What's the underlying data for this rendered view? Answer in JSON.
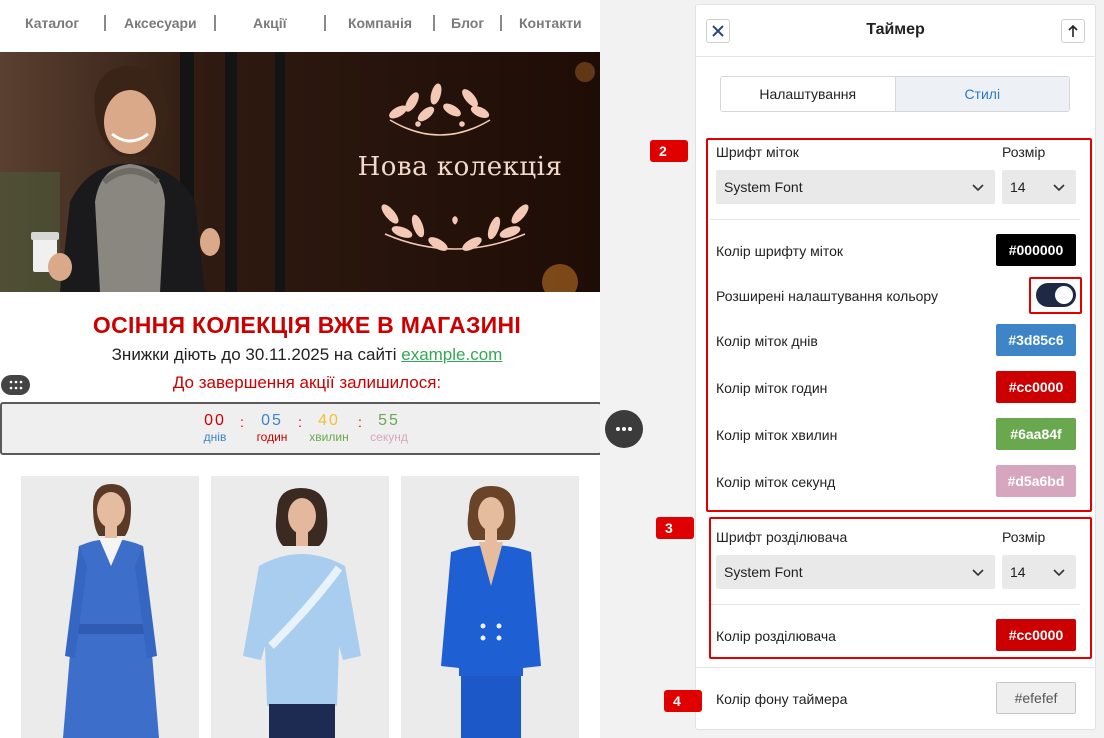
{
  "nav": {
    "items": [
      "Каталог",
      "Аксесуари",
      "Акції",
      "Компанія",
      "Блог",
      "Контакти"
    ]
  },
  "banner": {
    "title": "Нова колекція"
  },
  "promo": {
    "headline": "ОСІННЯ КОЛЕКЦІЯ ВЖЕ В МАГАЗИНІ",
    "subline_text": "Знижки діють до 30.11.2025 на сайті",
    "subline_link": "example.com",
    "countdown_label": "До завершення акції залишилося:"
  },
  "timer": {
    "separator": ":",
    "units": [
      {
        "value": "00",
        "label": "днів",
        "color": "#cc0000",
        "label_color": "#3d85c6"
      },
      {
        "value": "05",
        "label": "годин",
        "color": "#3d85c6",
        "label_color": "#cc0000"
      },
      {
        "value": "40",
        "label": "хвилин",
        "color": "#f1c232",
        "label_color": "#6aa84f"
      },
      {
        "value": "55",
        "label": "секунд",
        "color": "#6aa84f",
        "label_color": "#d5a6bd"
      }
    ],
    "background": "#efefef"
  },
  "panel": {
    "title": "Таймер",
    "close_icon": "close-icon",
    "collapse_icon": "arrow-up-icon",
    "tabs": [
      {
        "label": "Налаштування",
        "active": false
      },
      {
        "label": "Стилі",
        "active": true
      }
    ],
    "labels_font": {
      "label": "Шрифт міток",
      "size_label": "Розмір",
      "font_value": "System Font",
      "size_value": "14"
    },
    "labels_color": {
      "label": "Колір шрифту міток",
      "value": "#000000"
    },
    "advanced_color": {
      "label": "Розширені налаштування кольору",
      "enabled": true
    },
    "days_color": {
      "label": "Колір міток днів",
      "value": "#3d85c6"
    },
    "hours_color": {
      "label": "Колір міток годин",
      "value": "#cc0000"
    },
    "minutes_color": {
      "label": "Колір міток хвилин",
      "value": "#6aa84f"
    },
    "seconds_color": {
      "label": "Колір міток секунд",
      "value": "#d5a6bd"
    },
    "separator_font": {
      "label": "Шрифт розділювача",
      "size_label": "Розмір",
      "font_value": "System Font",
      "size_value": "14"
    },
    "separator_color": {
      "label": "Колір розділювача",
      "value": "#cc0000"
    },
    "timer_bg": {
      "label": "Колір фону таймера",
      "value": "#efefef"
    }
  },
  "steps": [
    "2",
    "3",
    "4"
  ],
  "colors": {
    "accent_red": "#cc0000",
    "frame_red": "#e00000",
    "link_green": "#32a852",
    "tab_blue": "#2b7bc2"
  }
}
